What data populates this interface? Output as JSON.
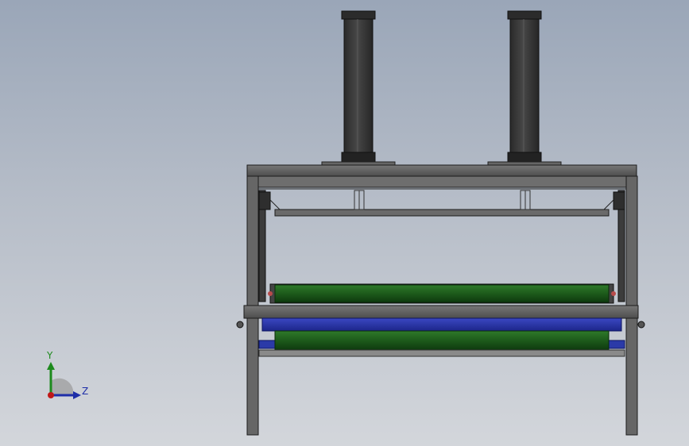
{
  "triad": {
    "y_label": "Y",
    "z_label": "Z",
    "colors": {
      "y_axis": "#1d8a1d",
      "z_axis": "#1e2ea8",
      "x_axis": "#c01818"
    }
  },
  "model": {
    "colors": {
      "frame": "#5e5e5e",
      "frame_edge": "#1c1c1c",
      "cylinder": "#3a3a3a",
      "roller": "#1f5f1c",
      "roller_shade": "#0d3a0d",
      "conveyor": "#2733a8"
    }
  }
}
